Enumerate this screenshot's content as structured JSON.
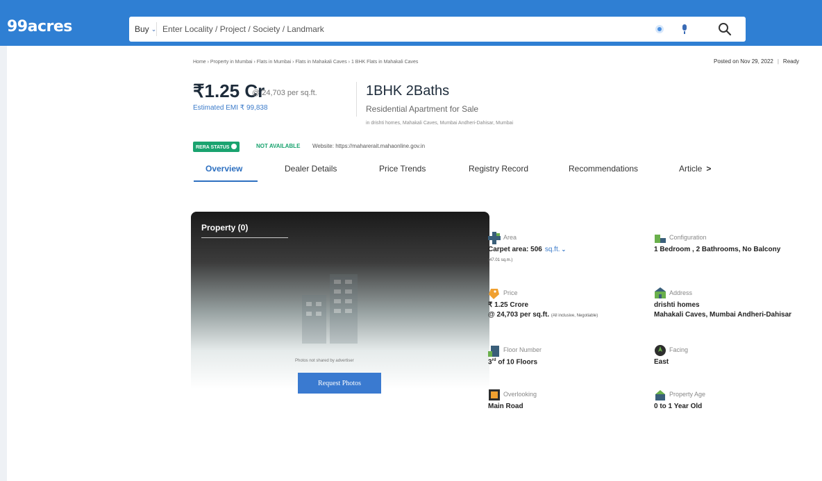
{
  "header": {
    "logo": "99acres",
    "buy_label": "Buy",
    "buy_chevron": "⌄",
    "search_placeholder": "Enter Locality / Project / Society / Landmark"
  },
  "breadcrumb": "Home › Property in Mumbai › Flats in Mumbai › Flats in Mahakali Caves › 1 BHK Flats in Mahakali Caves",
  "posted": {
    "text": "Posted on Nov 29, 2022",
    "sep": "|",
    "status": "Ready"
  },
  "price": {
    "main": "₹1.25 Cr",
    "rate": "@ 24,703 per sq.ft.",
    "emi": "Estimated EMI ₹ 99,838"
  },
  "listing": {
    "bhk": "1BHK 2Baths",
    "type": "Residential Apartment for Sale",
    "location": "in drishti homes, Mahakali Caves, Mumbai Andheri-Dahisar, Mumbai"
  },
  "rera": {
    "badge": "RERA STATUS",
    "status": "NOT AVAILABLE",
    "website": "Website: https://maharerait.mahaonline.gov.in"
  },
  "tabs": {
    "overview": "Overview",
    "dealer": "Dealer Details",
    "price_trends": "Price Trends",
    "registry": "Registry Record",
    "recommendations": "Recommendations",
    "articles": "Article",
    "chevron": ">"
  },
  "photo": {
    "title": "Property (0)",
    "note": "Photos not shared by advertiser",
    "button": "Request Photos"
  },
  "attributes": {
    "area": {
      "label": "Area",
      "value": "Carpet area: 506",
      "unit": "sq.ft.",
      "unit_chevron": "⌄",
      "sub": "(47.01 sq.m.)"
    },
    "configuration": {
      "label": "Configuration",
      "value": "1 Bedroom , 2 Bathrooms, No Balcony"
    },
    "price": {
      "label": "Price",
      "value": "₹ 1.25 Crore",
      "rate": "@ 24,703 per sq.ft.",
      "note": "(All inclusive, Negotiable)"
    },
    "address": {
      "label": "Address",
      "line1": "drishti homes",
      "line2": "Mahakali Caves, Mumbai Andheri-Dahisar"
    },
    "floor": {
      "label": "Floor Number",
      "floor": "3",
      "floor_suffix": "rd",
      "total": "of 10 Floors"
    },
    "facing": {
      "label": "Facing",
      "value": "East"
    },
    "overlooking": {
      "label": "Overlooking",
      "value": "Main Road"
    },
    "age": {
      "label": "Property Age",
      "value": "0 to 1 Year Old"
    }
  },
  "colors": {
    "header_blue": "#2f7fd3",
    "link_blue": "#3a7ac9",
    "rera_green": "#1aa36f",
    "icon_green": "#6ab04c",
    "icon_orange": "#f0a030"
  }
}
